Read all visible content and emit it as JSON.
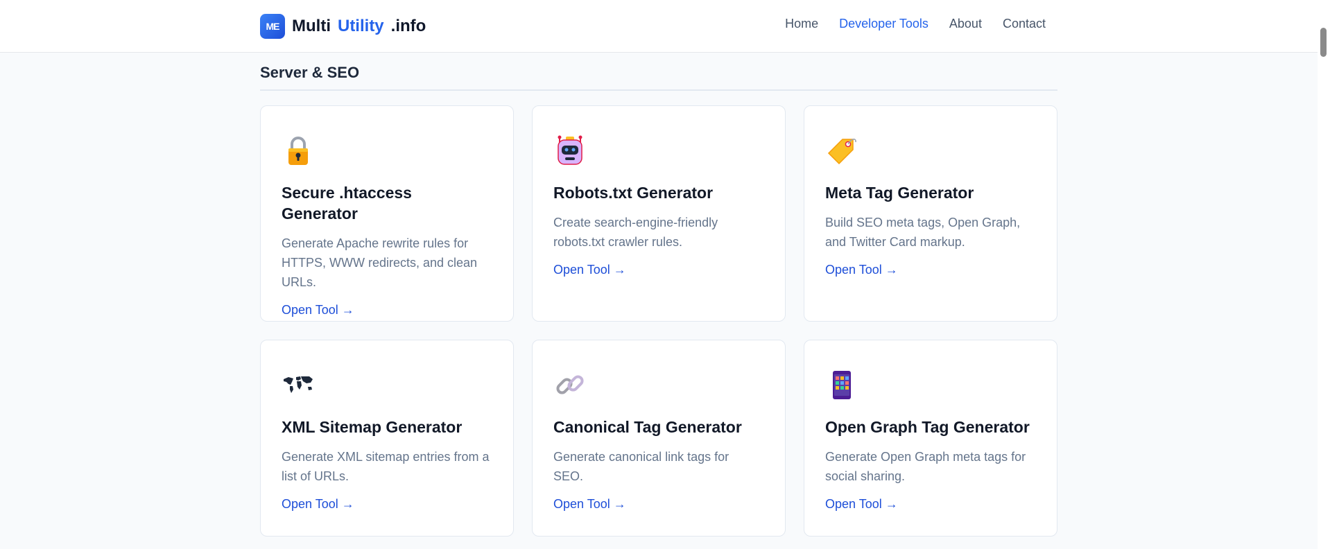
{
  "brand": {
    "logo": "ME",
    "word1": "Multi",
    "word2": "Utility",
    "word3": ".info"
  },
  "nav": [
    {
      "label": "Home"
    },
    {
      "label": "Developer Tools"
    },
    {
      "label": "About"
    },
    {
      "label": "Contact"
    }
  ],
  "section": {
    "title": "Server & SEO"
  },
  "cards": [
    {
      "icon": "lock-icon",
      "title": "Secure .htaccess Generator",
      "desc": "Generate Apache rewrite rules for HTTPS, WWW redirects, and clean URLs.",
      "link": "Open Tool →"
    },
    {
      "icon": "robot-icon",
      "title": "Robots.txt Generator",
      "desc": "Create search-engine-friendly robots.txt crawler rules.",
      "link": "Open Tool →"
    },
    {
      "icon": "tag-icon",
      "title": "Meta Tag Generator",
      "desc": "Build SEO meta tags, Open Graph, and Twitter Card markup.",
      "link": "Open Tool →"
    },
    {
      "icon": "world-map-icon",
      "title": "XML Sitemap Generator",
      "desc": "Generate XML sitemap entries from a list of URLs.",
      "link": "Open Tool →"
    },
    {
      "icon": "link-icon",
      "title": "Canonical Tag Generator",
      "desc": "Generate canonical link tags for SEO.",
      "link": "Open Tool →"
    },
    {
      "icon": "mobile-phone-icon",
      "title": "Open Graph Tag Generator",
      "desc": "Generate Open Graph meta tags for social sharing.",
      "link": "Open Tool →"
    }
  ],
  "colors": {
    "accent": "#2563eb",
    "text": "#0f172a",
    "muted": "#64748b",
    "background": "#f8fafc"
  }
}
